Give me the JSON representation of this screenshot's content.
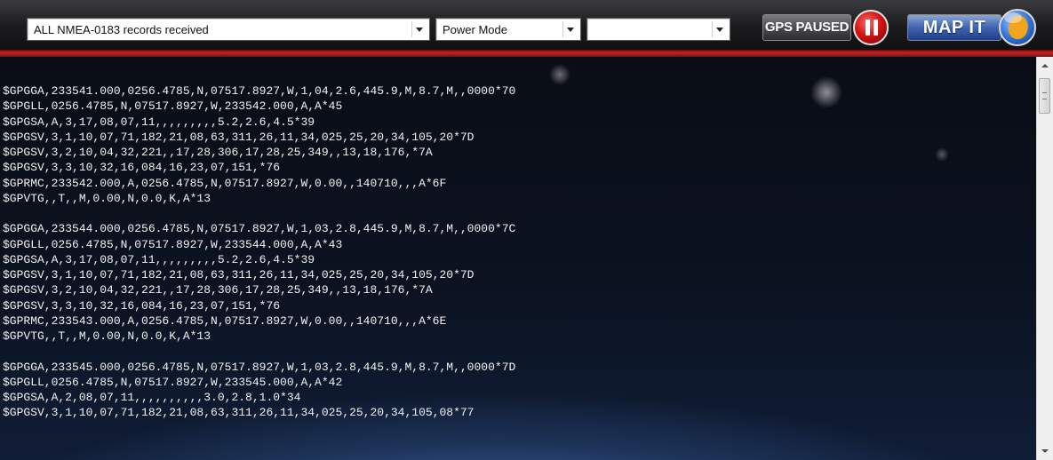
{
  "toolbar": {
    "record_filter": {
      "value": "ALL NMEA-0183 records received"
    },
    "mode_select": {
      "value": "Power Mode"
    },
    "third_select": {
      "value": ""
    },
    "gps_status_label": "GPS PAUSED",
    "map_button_label": "MAP IT"
  },
  "log": {
    "lines": [
      "$GPGGA,233541.000,0256.4785,N,07517.8927,W,1,04,2.6,445.9,M,8.7,M,,0000*70",
      "$GPGLL,0256.4785,N,07517.8927,W,233542.000,A,A*45",
      "$GPGSA,A,3,17,08,07,11,,,,,,,,,5.2,2.6,4.5*39",
      "$GPGSV,3,1,10,07,71,182,21,08,63,311,26,11,34,025,25,20,34,105,20*7D",
      "$GPGSV,3,2,10,04,32,221,,17,28,306,17,28,25,349,,13,18,176,*7A",
      "$GPGSV,3,3,10,32,16,084,16,23,07,151,*76",
      "$GPRMC,233542.000,A,0256.4785,N,07517.8927,W,0.00,,140710,,,A*6F",
      "$GPVTG,,T,,M,0.00,N,0.0,K,A*13",
      "",
      "$GPGGA,233544.000,0256.4785,N,07517.8927,W,1,03,2.8,445.9,M,8.7,M,,0000*7C",
      "$GPGLL,0256.4785,N,07517.8927,W,233544.000,A,A*43",
      "$GPGSA,A,3,17,08,07,11,,,,,,,,,5.2,2.6,4.5*39",
      "$GPGSV,3,1,10,07,71,182,21,08,63,311,26,11,34,025,25,20,34,105,20*7D",
      "$GPGSV,3,2,10,04,32,221,,17,28,306,17,28,25,349,,13,18,176,*7A",
      "$GPGSV,3,3,10,32,16,084,16,23,07,151,*76",
      "$GPRMC,233543.000,A,0256.4785,N,07517.8927,W,0.00,,140710,,,A*6E",
      "$GPVTG,,T,,M,0.00,N,0.0,K,A*13",
      "",
      "$GPGGA,233545.000,0256.4785,N,07517.8927,W,1,03,2.8,445.9,M,8.7,M,,0000*7D",
      "$GPGLL,0256.4785,N,07517.8927,W,233545.000,A,A*42",
      "$GPGSA,A,2,08,07,11,,,,,,,,,,3.0,2.8,1.0*34",
      "$GPGSV,3,1,10,07,71,182,21,08,63,311,26,11,34,025,25,20,34,105,08*77"
    ]
  },
  "icons": {
    "pause": "pause-icon",
    "globe": "globe-icon"
  }
}
